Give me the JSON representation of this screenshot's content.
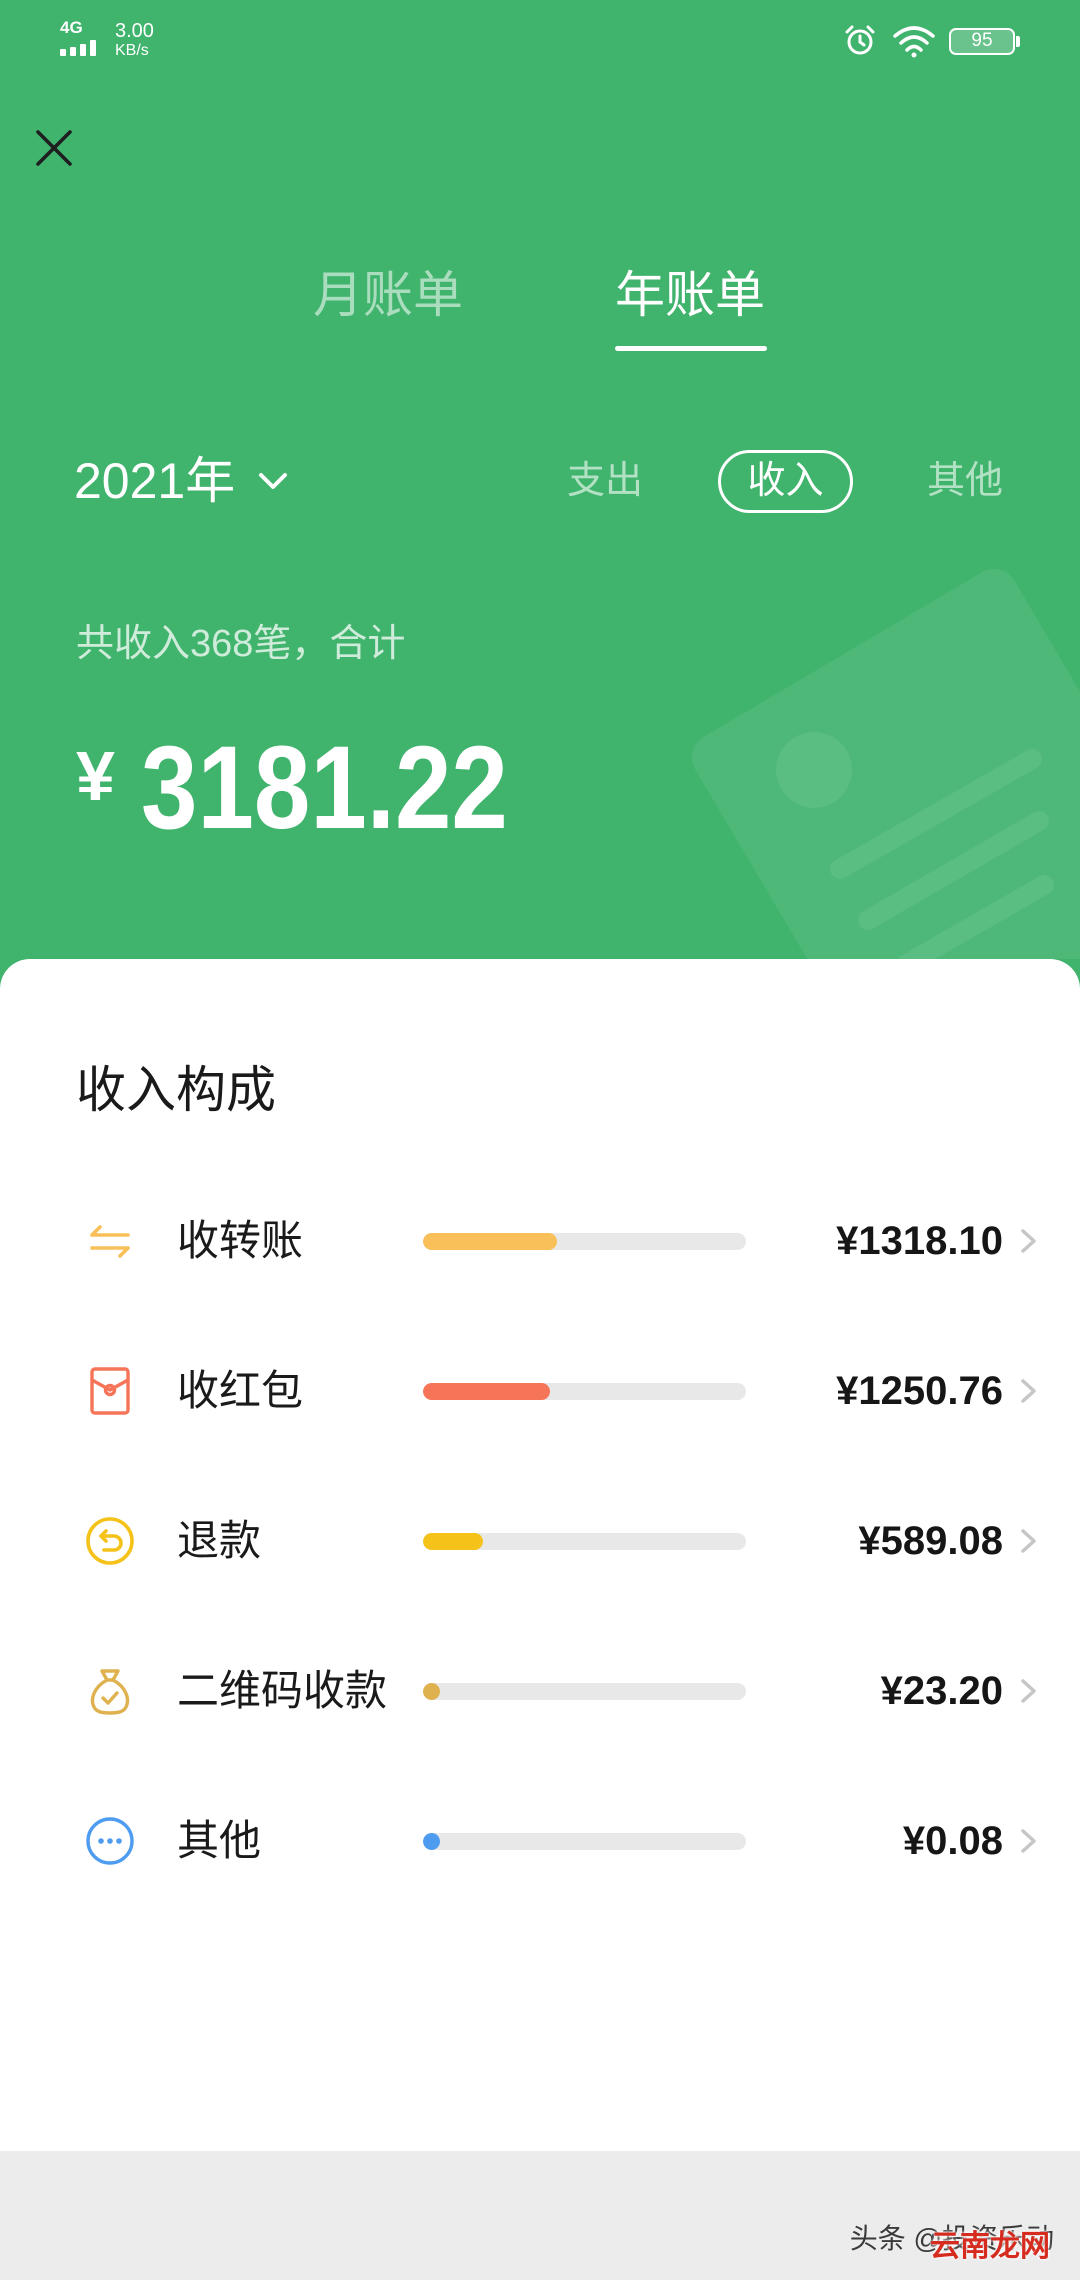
{
  "status_bar": {
    "network": "4G",
    "speed_value": "3.00",
    "speed_unit": "KB/s",
    "icons": [
      "signal-icon",
      "alarm-icon",
      "wifi-icon",
      "battery-icon"
    ],
    "battery": "95"
  },
  "header": {
    "close_icon": "close-icon",
    "tabs": [
      {
        "label": "月账单",
        "active": false
      },
      {
        "label": "年账单",
        "active": true
      }
    ]
  },
  "filter": {
    "year": "2021年",
    "year_icon": "chevron-down-icon",
    "types": [
      {
        "label": "支出",
        "selected": false
      },
      {
        "label": "收入",
        "selected": true
      },
      {
        "label": "其他",
        "selected": false
      }
    ]
  },
  "summary": {
    "caption": "共收入368笔，合计",
    "currency": "¥",
    "amount": "3181.22"
  },
  "breakdown": {
    "title": "收入构成",
    "items": [
      {
        "icon": "transfer-icon",
        "label": "收转账",
        "amount": "¥1318.10",
        "fill": 0.414,
        "color": "#f9bf58"
      },
      {
        "icon": "red-packet-icon",
        "label": "收红包",
        "amount": "¥1250.76",
        "fill": 0.393,
        "color": "#f67558"
      },
      {
        "icon": "refund-icon",
        "label": "退款",
        "amount": "¥589.08",
        "fill": 0.185,
        "color": "#f5c219"
      },
      {
        "icon": "money-bag-icon",
        "label": "二维码收款",
        "amount": "¥23.20",
        "fill": 0.007,
        "color": "#dfb24f"
      },
      {
        "icon": "more-icon",
        "label": "其他",
        "amount": "¥0.08",
        "fill": 0.0,
        "color": "#4e9cf0"
      }
    ],
    "row_action_icon": "chevron-right-icon"
  },
  "watermark": {
    "source": "头条 @投资乐动",
    "overlay": "云南龙网"
  },
  "colors": {
    "header_bg": "#40b36d",
    "card_bg": "#ffffff",
    "footer_bg": "#ececec",
    "bar_track": "#e8e8e8",
    "chevron": "#c6c6c6"
  }
}
